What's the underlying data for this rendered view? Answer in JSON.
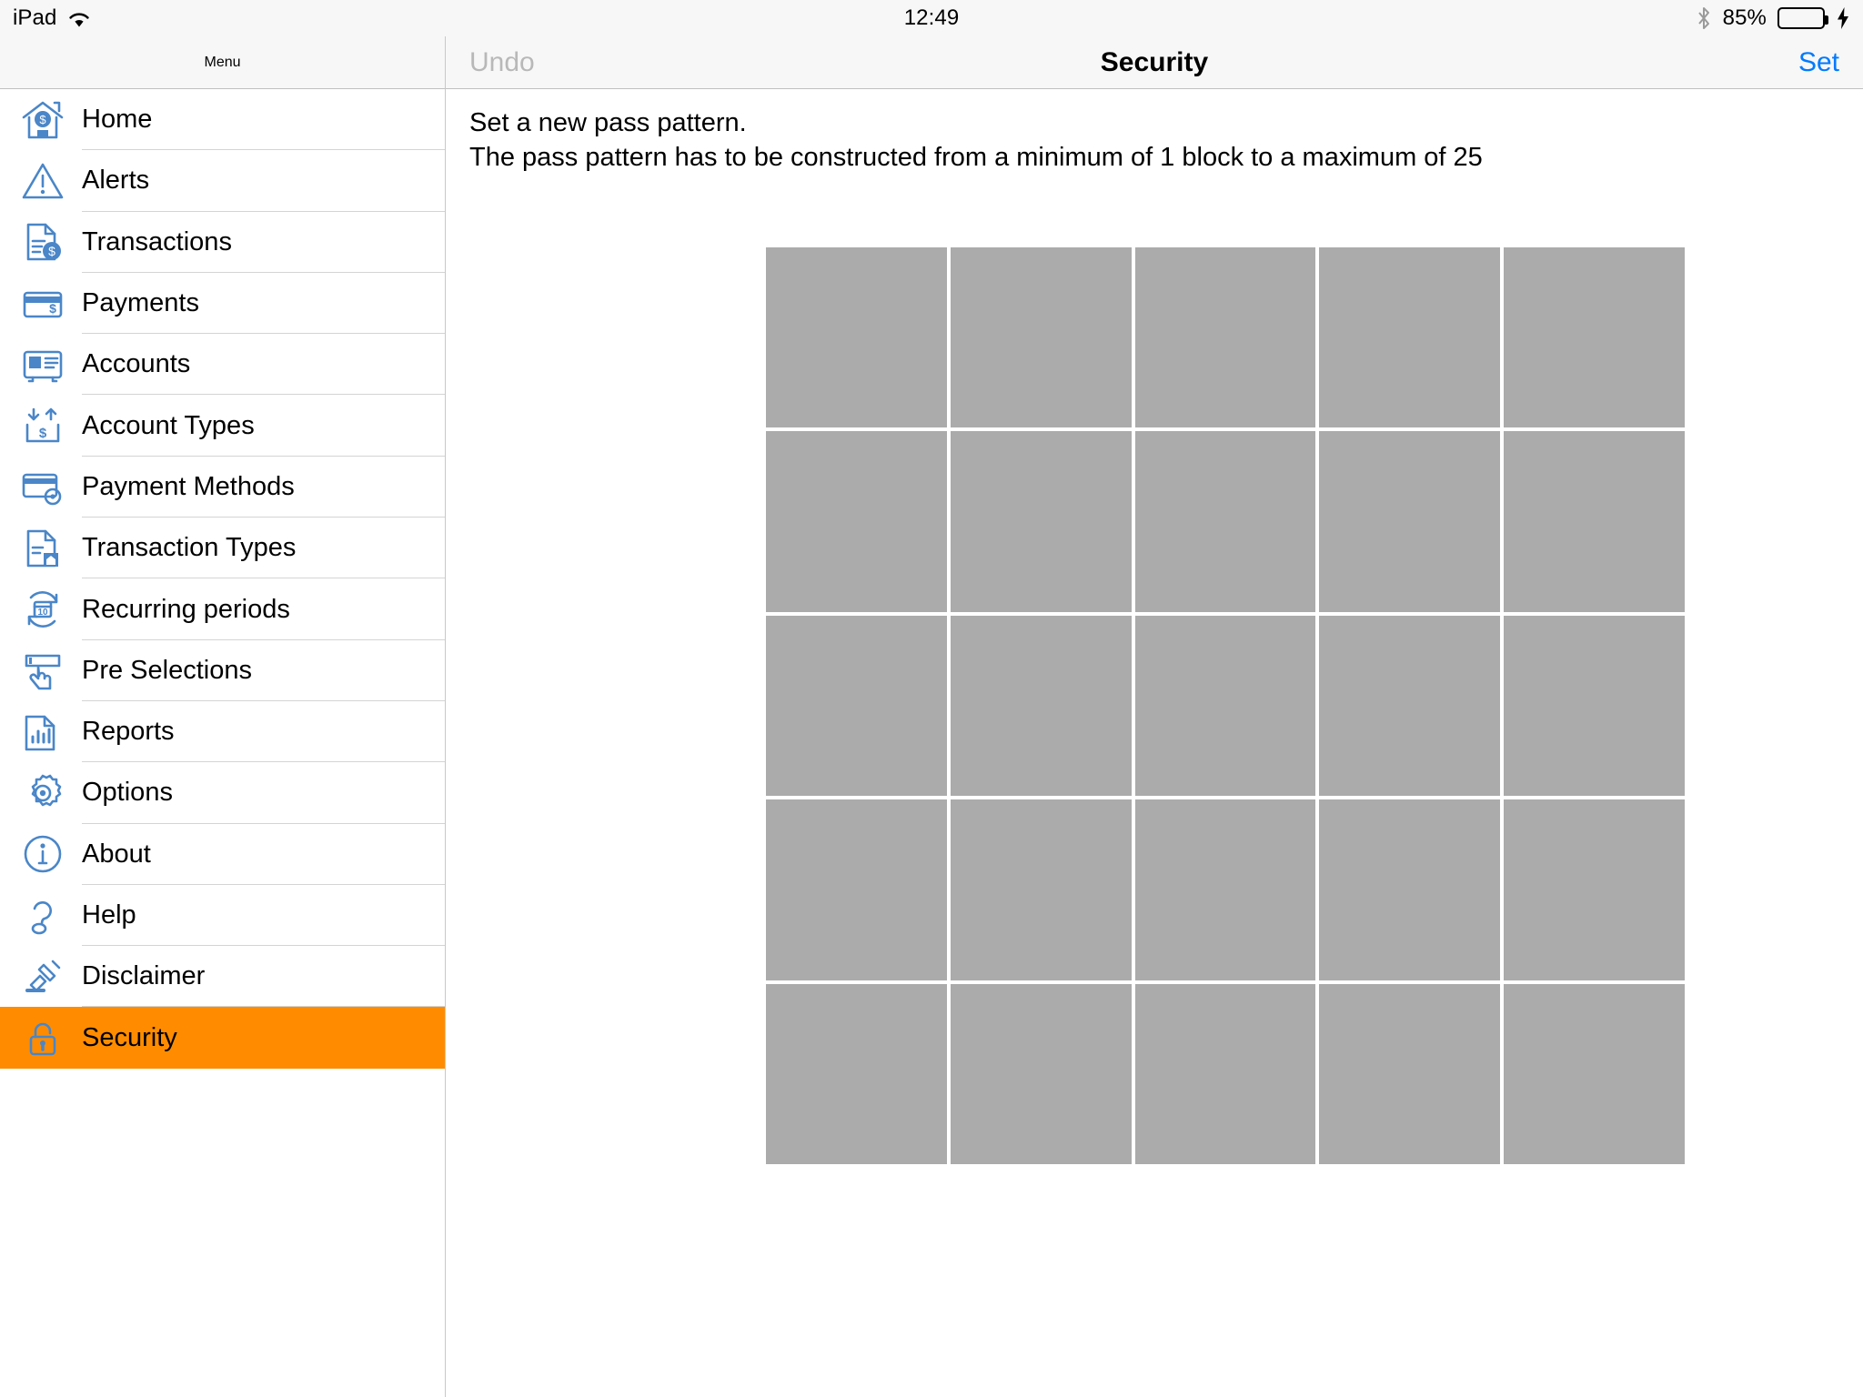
{
  "statusbar": {
    "device": "iPad",
    "wifi_icon": "wifi-icon",
    "time": "12:49",
    "bluetooth_icon": "bluetooth-icon",
    "battery_percent": "85%",
    "battery_level": 85,
    "battery_color": "#4cd964",
    "charging_icon": "lightning-bolt-icon"
  },
  "sidebar": {
    "title": "Menu",
    "selected_index": 15,
    "highlight_color": "#ff8c00",
    "icon_color": "#4a86c8",
    "items": [
      {
        "label": "Home",
        "icon": "house-dollar-icon"
      },
      {
        "label": "Alerts",
        "icon": "warning-triangle-icon"
      },
      {
        "label": "Transactions",
        "icon": "document-dollar-icon"
      },
      {
        "label": "Payments",
        "icon": "credit-card-dollar-icon"
      },
      {
        "label": "Accounts",
        "icon": "id-card-icon"
      },
      {
        "label": "Account Types",
        "icon": "arrows-dollar-tray-icon"
      },
      {
        "label": "Payment Methods",
        "icon": "credit-card-gear-icon"
      },
      {
        "label": "Transaction Types",
        "icon": "document-house-icon"
      },
      {
        "label": "Recurring periods",
        "icon": "calendar-refresh-icon"
      },
      {
        "label": "Pre Selections",
        "icon": "hand-tap-field-icon"
      },
      {
        "label": "Reports",
        "icon": "document-barchart-icon"
      },
      {
        "label": "Options",
        "icon": "gear-icon"
      },
      {
        "label": "About",
        "icon": "info-circle-icon"
      },
      {
        "label": "Help",
        "icon": "question-mark-icon"
      },
      {
        "label": "Disclaimer",
        "icon": "gavel-icon"
      },
      {
        "label": "Security",
        "icon": "padlock-icon"
      }
    ]
  },
  "navbar": {
    "undo_label": "Undo",
    "undo_disabled": true,
    "title": "Security",
    "set_label": "Set",
    "set_color": "#007aff"
  },
  "content": {
    "instruction_line1": "Set a new pass pattern.",
    "instruction_line2": "The pass pattern has to be constructed from a minimum of 1 block to a maximum of 25"
  },
  "pattern_grid": {
    "rows": 5,
    "columns": 5,
    "total_blocks": 25,
    "min_blocks": 1,
    "max_blocks": 25,
    "cell_color": "#ababab",
    "gap_color": "#ffffff",
    "selected_cells": []
  }
}
